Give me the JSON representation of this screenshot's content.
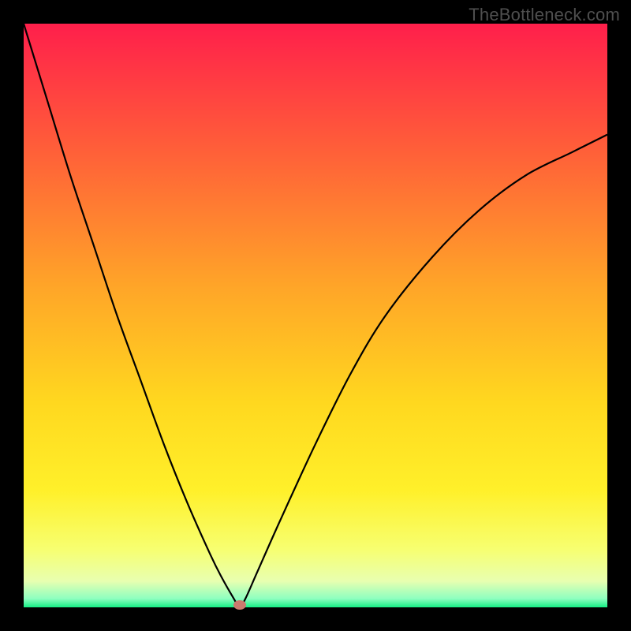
{
  "watermark": "TheBottleneck.com",
  "colors": {
    "frame": "#000000",
    "curve": "#000000",
    "min_marker": "#cc7a6e",
    "gradient_stops": [
      {
        "offset": 0.0,
        "color": "#ff1f4b"
      },
      {
        "offset": 0.2,
        "color": "#ff5a3a"
      },
      {
        "offset": 0.45,
        "color": "#ffa528"
      },
      {
        "offset": 0.65,
        "color": "#ffd81f"
      },
      {
        "offset": 0.8,
        "color": "#fff02a"
      },
      {
        "offset": 0.9,
        "color": "#f7ff70"
      },
      {
        "offset": 0.955,
        "color": "#e8ffb0"
      },
      {
        "offset": 0.985,
        "color": "#8effc0"
      },
      {
        "offset": 1.0,
        "color": "#15ef85"
      }
    ]
  },
  "chart_data": {
    "type": "line",
    "title": "",
    "xlabel": "",
    "ylabel": "",
    "xlim": [
      0,
      100
    ],
    "ylim": [
      0,
      100
    ],
    "legend": false,
    "grid": false,
    "series": [
      {
        "name": "bottleneck-curve",
        "x": [
          0,
          4,
          8,
          12,
          16,
          20,
          24,
          28,
          32,
          34,
          36,
          37,
          38,
          40,
          44,
          50,
          56,
          62,
          70,
          78,
          86,
          94,
          100
        ],
        "y": [
          100,
          87,
          74,
          62,
          50,
          39,
          28,
          18,
          9,
          5,
          1.5,
          0,
          1.5,
          6,
          15,
          28,
          40,
          50,
          60,
          68,
          74,
          78,
          81
        ]
      }
    ],
    "min_point": {
      "x": 37,
      "y": 0
    },
    "background": "vertical-gradient"
  }
}
